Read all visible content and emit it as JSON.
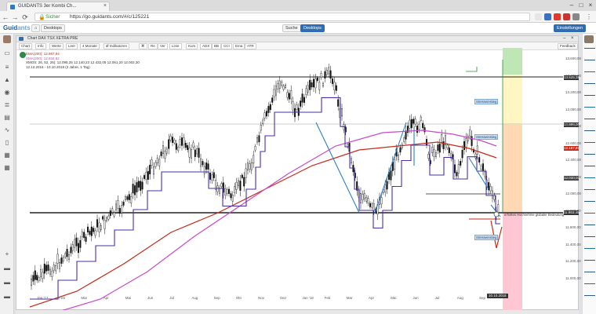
{
  "browser": {
    "tab_title": "GUIDANTS 3er Kombi Ch...",
    "security_label": "Sicher",
    "url": "https://go.guidants.com/#/c/125221"
  },
  "app": {
    "logo_text": "Guid",
    "logo_accent": "ants",
    "header_left_button": "Desktops",
    "header_search_button": "Suche",
    "header_active_button": "Desktops",
    "header_right_button": "Einstellungen"
  },
  "chart_window": {
    "title": "Chart DAX TSX XETRA PRE",
    "toolbar": [
      "Chart",
      "Info",
      "Werte",
      "Leer",
      "4 Monate",
      "Ø Indikatoren",
      "⌘",
      "Re",
      "Ver",
      "Linie",
      "Kurs",
      "ADX",
      "BB",
      "CCI",
      "Ema",
      "ATR"
    ],
    "toolbar_right": "Feedback"
  },
  "legend": {
    "ema200": "EMA(200): 12.987,94",
    "sma200": "SMA(200): 12.934,82",
    "ohlc": "XMOS: 26, 52, 26): 12.095,25   12.140,23  12.432,05  12.061,20  12.002,30",
    "range": "12.12.2016 - 10.10.2018  (2 Jahre, 1 Tag)"
  },
  "price_axis": [
    "13.600,00",
    "13.400,00",
    "13.200,00",
    "13.000,00",
    "12.800,00",
    "12.600,00",
    "12.400,00",
    "12.200,00",
    "12.000,00",
    "11.800,00",
    "11.600,00",
    "11.400,00",
    "11.200,00",
    "11.000,00"
  ],
  "price_badges": {
    "top": "13.525,35",
    "mid": "12.998,00",
    "red": "12.187,87",
    "dark": "12.030,00",
    "bottom": "11.863,45"
  },
  "months": [
    "Jan '17",
    "Feb",
    "Mar",
    "Apr",
    "Mai",
    "Jun",
    "Jul",
    "Aug",
    "Sep",
    "Okt",
    "Nov",
    "Dez",
    "Jan '18",
    "Feb",
    "Mar",
    "Apr",
    "Mai",
    "Jun",
    "Jul",
    "Aug",
    "Sep"
  ],
  "annotations": {
    "box1": "Stresseinstieg",
    "box2": "Stresseinstieg",
    "box3": "Stresseinstieg",
    "support_text": "erholtes Hochnehme globaler Bedeutung",
    "date_badge": "10.10.2018"
  },
  "colors": {
    "ema": "#c72a1a",
    "sma": "#c74ac7",
    "price": "#000000",
    "trend_blue": "#2b7fc2",
    "purple_line": "#4b2fa8",
    "zone_green": "#bfe6b5",
    "zone_yellow": "#fff6c2",
    "zone_orange": "#ffd9b3",
    "zone_pink": "#ffc7d4"
  }
}
